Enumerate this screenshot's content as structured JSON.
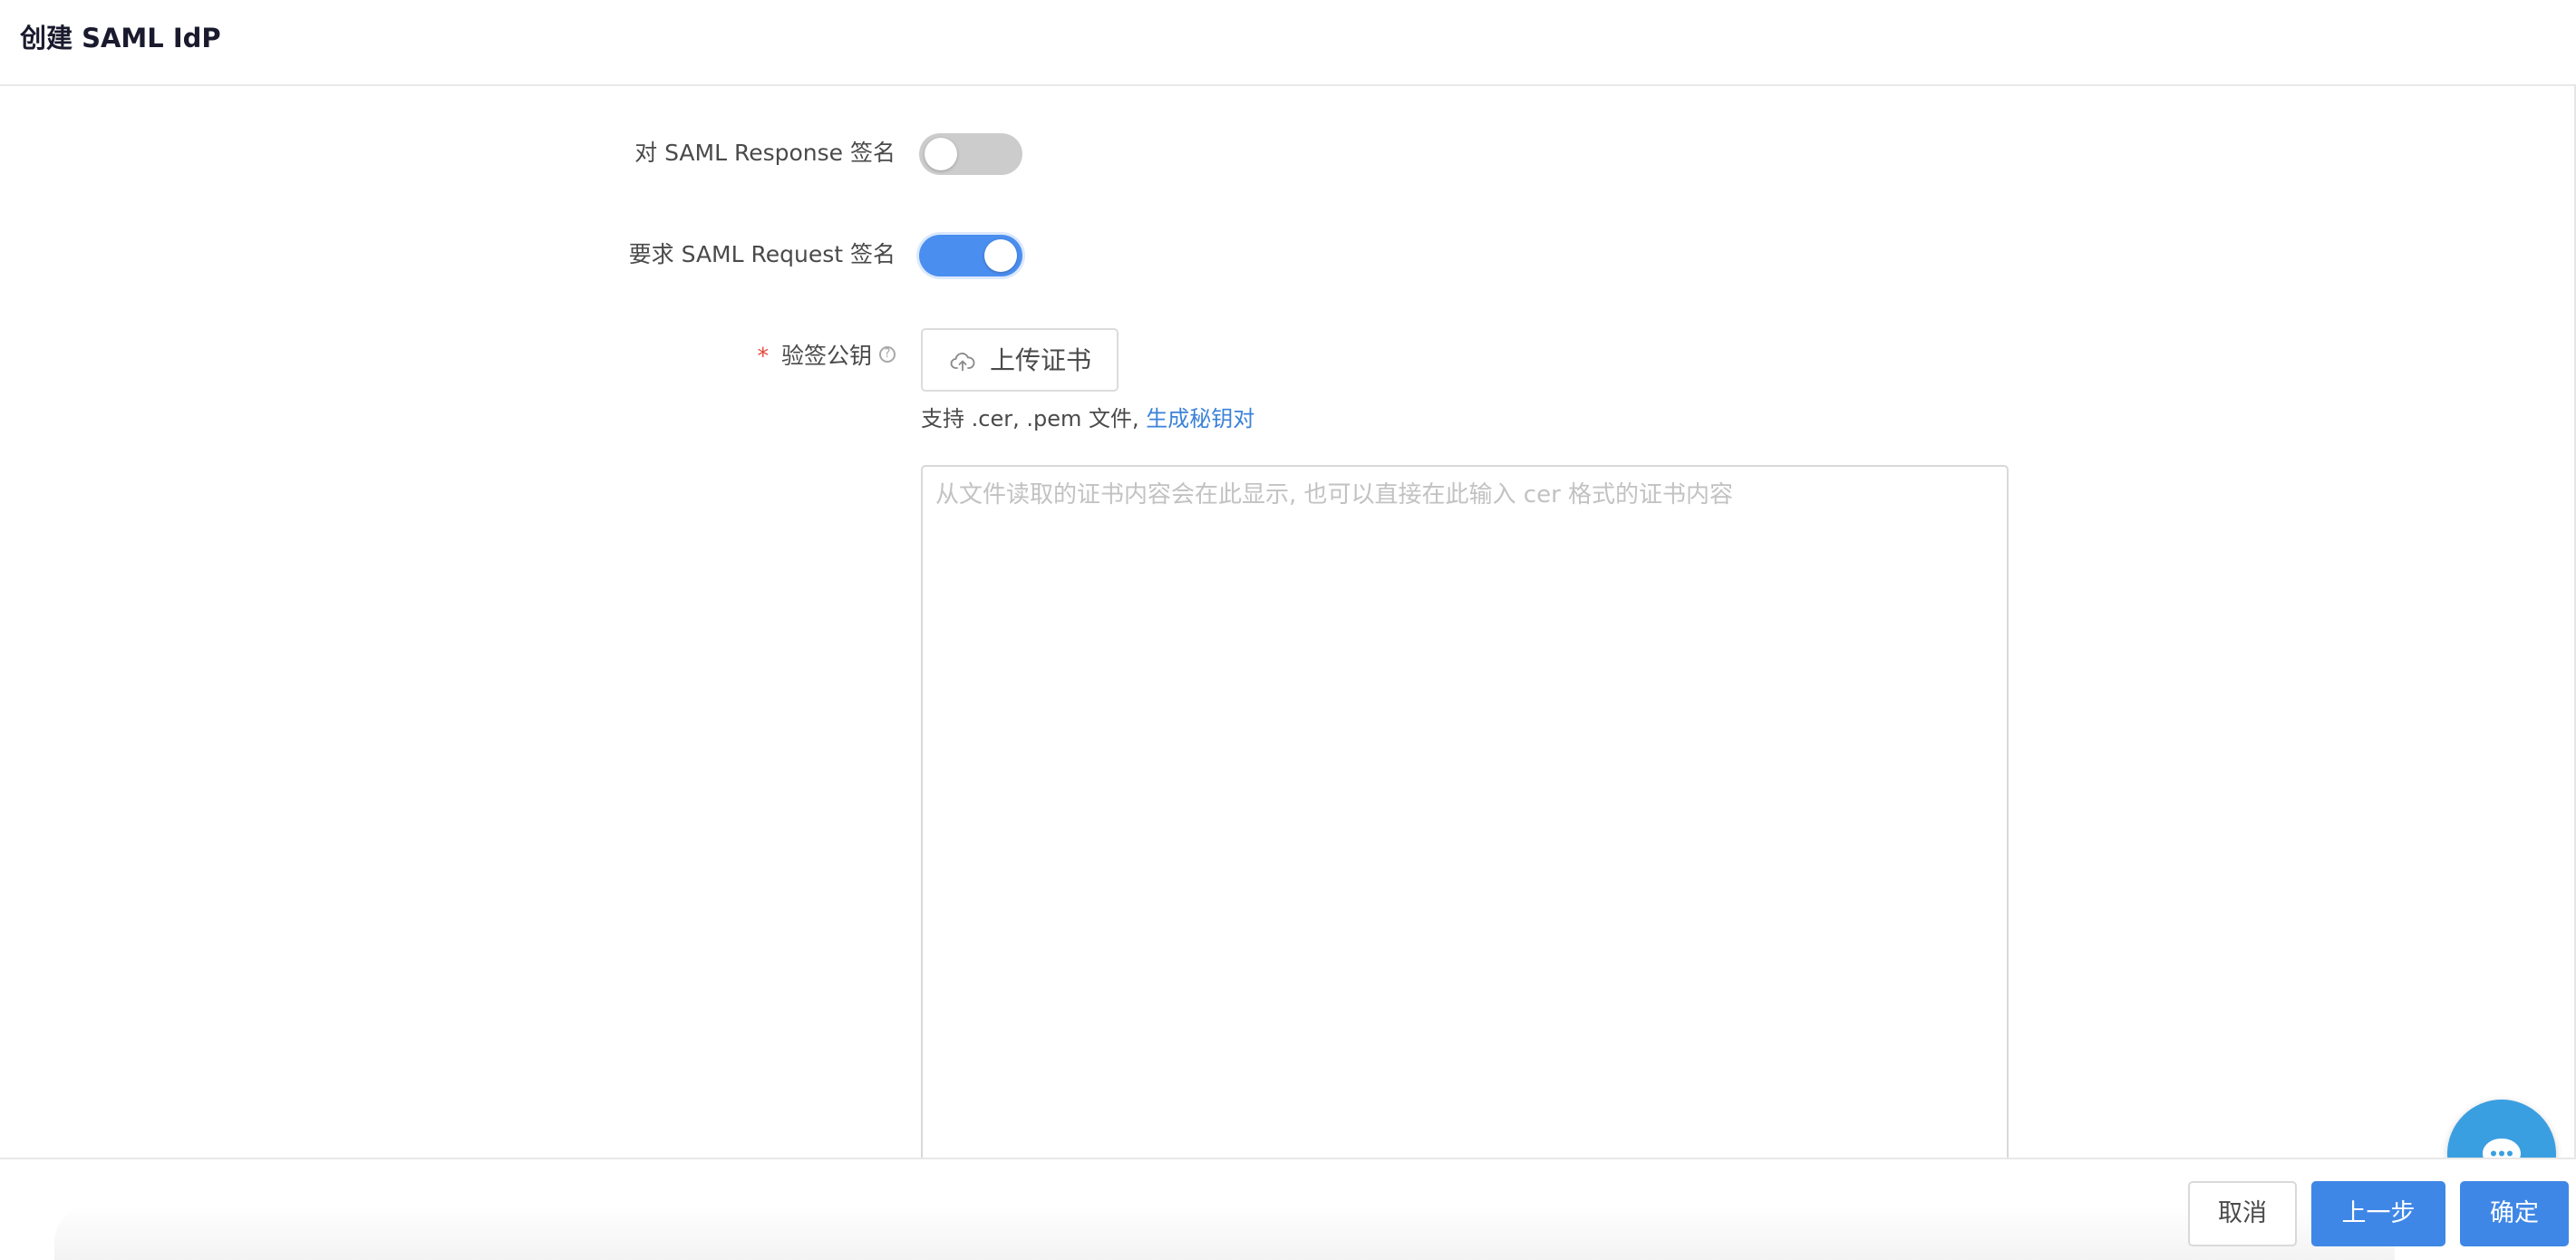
{
  "header": {
    "title": "创建 SAML IdP"
  },
  "form": {
    "sign_response": {
      "label": "对 SAML Response 签名",
      "enabled": false
    },
    "require_request_signing": {
      "label": "要求 SAML Request 签名",
      "enabled": true
    },
    "public_key": {
      "required_mark": "*",
      "label": "验签公钥",
      "help_icon": "question-circle-icon",
      "upload_icon": "cloud-upload-icon",
      "upload_label": "上传证书",
      "hint_text": "支持 .cer, .pem 文件, ",
      "hint_link": "生成秘钥对",
      "textarea_value": "",
      "textarea_placeholder": "从文件读取的证书内容会在此显示, 也可以直接在此输入 cer 格式的证书内容"
    }
  },
  "footer": {
    "cancel_label": "取消",
    "prev_label": "上一步",
    "confirm_label": "确定"
  },
  "chat_fab": {
    "icon": "chat-bubble-icon"
  },
  "colors": {
    "primary": "#3f87e6",
    "toggle_on": "#4a8ef0",
    "toggle_off": "#cccccc",
    "link": "#3b82d9",
    "required": "#e8483a",
    "chat_fab": "#3a9fe0"
  }
}
